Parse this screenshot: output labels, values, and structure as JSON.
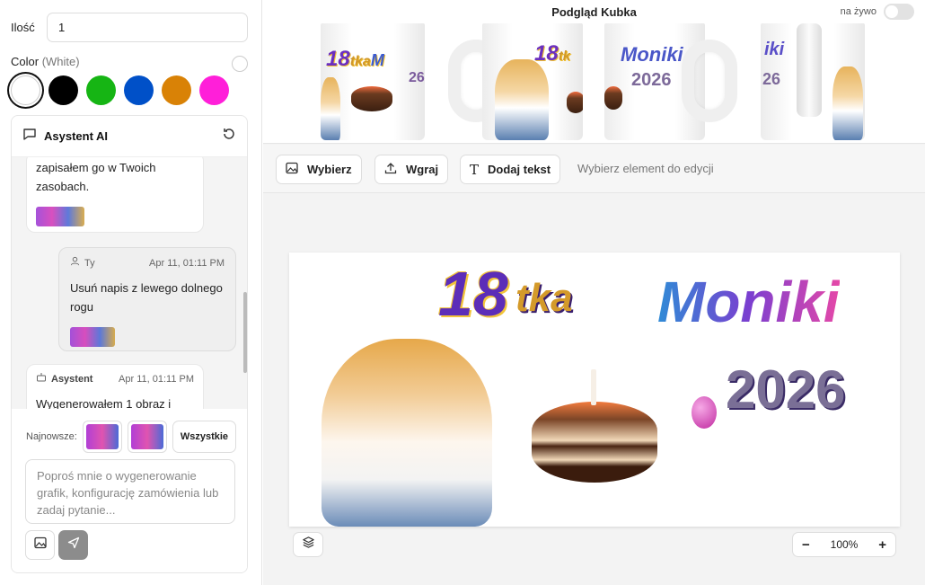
{
  "quantity": {
    "label": "Ilość",
    "value": "1"
  },
  "color": {
    "label": "Color",
    "selected": "(White)",
    "swatches": [
      "#ffffff",
      "#000000",
      "#16b514",
      "#0050c8",
      "#d98206",
      "#ff1fd9"
    ]
  },
  "assistant": {
    "title": "Asystent AI",
    "messages": [
      {
        "role": "assistant",
        "text": "zapisałem go w Twoich zasobach."
      },
      {
        "role": "user",
        "who": "Ty",
        "time": "Apr 11, 01:11 PM",
        "text": "Usuń napis z lewego dolnego rogu"
      },
      {
        "role": "assistant",
        "who": "Asystent",
        "time": "Apr 11, 01:11 PM",
        "text": "Wygenerowałem 1 obraz i"
      }
    ],
    "newest_label": "Najnowsze:",
    "all_button": "Wszystkie",
    "prompt_placeholder": "Poproś mnie o wygenerowanie grafik, konfigurację zamówienia lub zadaj pytanie..."
  },
  "preview": {
    "title": "Podgląd Kubka",
    "live_label": "na żywo",
    "live_on": false
  },
  "toolbar": {
    "select": "Wybierz",
    "upload": "Wgraj",
    "add_text": "Dodaj tekst",
    "hint": "Wybierz element do edycji"
  },
  "design": {
    "line1a": "18",
    "line1b": "tka",
    "line1c": "Moniki",
    "line2": "2026"
  },
  "zoom": {
    "minus": "−",
    "level": "100%",
    "plus": "+"
  }
}
